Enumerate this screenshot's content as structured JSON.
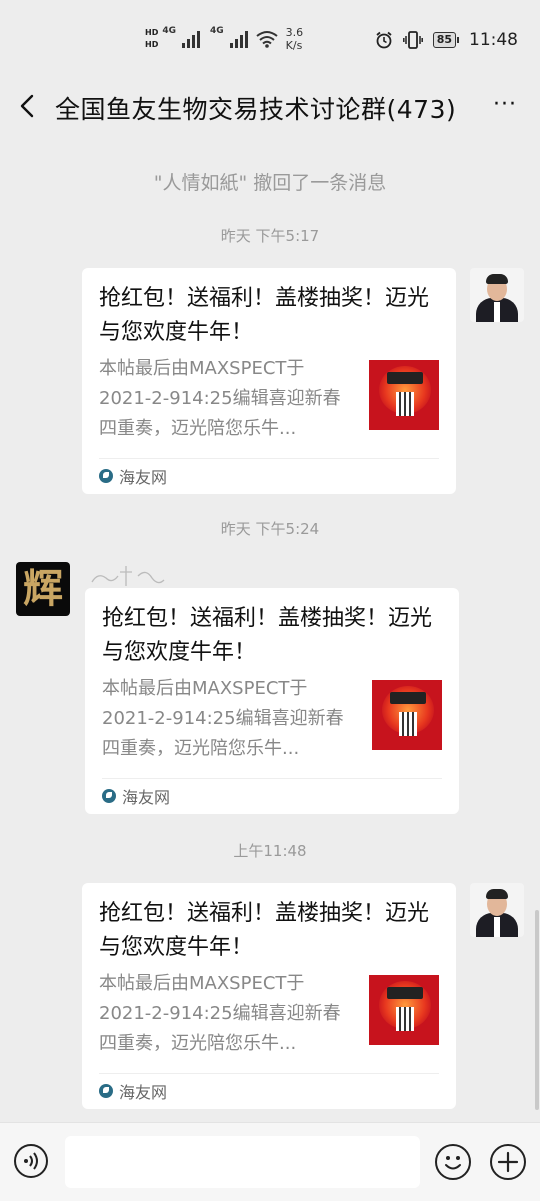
{
  "status_bar": {
    "hd1": "HD",
    "hd2": "HD",
    "net1": "4G",
    "net2": "4G",
    "speed_value": "3.6",
    "speed_unit": "K/s",
    "battery": "85",
    "time": "11:48"
  },
  "header": {
    "title": "全国鱼友生物交易技术讨论群(473)",
    "more_label": "···"
  },
  "system": {
    "recall_notice": "\"人情如紙\" 撤回了一条消息"
  },
  "messages": [
    {
      "time": "昨天 下午5:17",
      "side": "right",
      "title": "抢红包！送福利！盖楼抽奖！迈光与您欢度牛年！",
      "desc": "本帖最后由MAXSPECT于2021-2-914:25编辑喜迎新春四重奏，迈光陪您乐牛...",
      "source": "海友网"
    },
    {
      "time": "昨天 下午5:24",
      "side": "left",
      "title": "抢红包！送福利！盖楼抽奖！迈光与您欢度牛年！",
      "desc": "本帖最后由MAXSPECT于2021-2-914:25编辑喜迎新春四重奏，迈光陪您乐牛...",
      "source": "海友网"
    },
    {
      "time": "上午11:48",
      "side": "right",
      "title": "抢红包！送福利！盖楼抽奖！迈光与您欢度牛年！",
      "desc": "本帖最后由MAXSPECT于2021-2-914:25编辑喜迎新春四重奏，迈光陪您乐牛...",
      "source": "海友网"
    }
  ],
  "avatar_left_char": "辉",
  "input": {
    "placeholder": ""
  },
  "colors": {
    "background": "#ededed",
    "card": "#ffffff",
    "thumb_red": "#c7131d",
    "source_icon": "#2a6c86"
  }
}
